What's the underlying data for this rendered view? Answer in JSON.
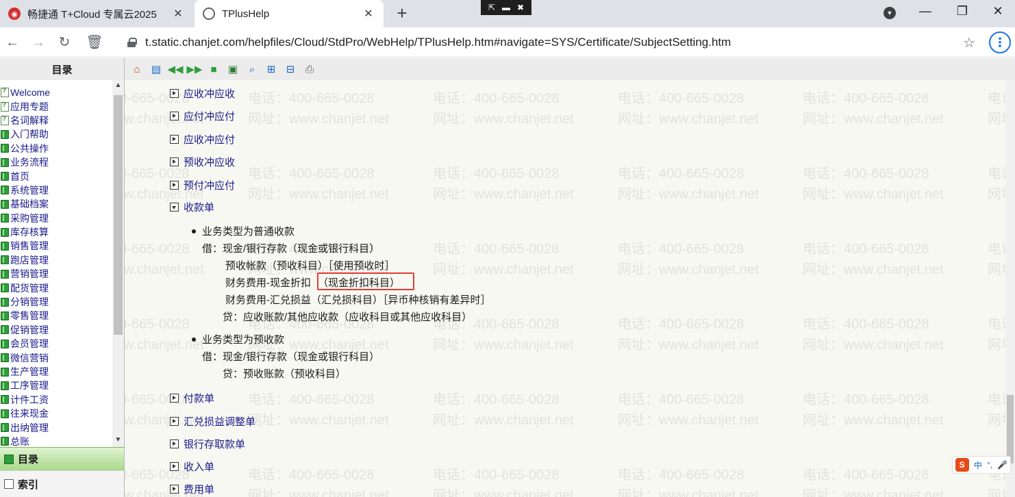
{
  "browser": {
    "tabs": [
      {
        "title": "畅捷通 T+Cloud 专属云2025",
        "active": false
      },
      {
        "title": "TPlusHelp",
        "active": true
      }
    ],
    "url": "t.static.chanjet.com/helpfiles/Cloud/StdPro/WebHelp/TPlusHelp.htm#navigate=SYS/Certificate/SubjectSetting.htm"
  },
  "help": {
    "toc_title": "目录",
    "toc_items": [
      {
        "label": "Welcome",
        "icon": "page-icon"
      },
      {
        "label": "应用专题",
        "icon": "page-icon"
      },
      {
        "label": "名词解释",
        "icon": "page-icon"
      },
      {
        "label": "入门帮助",
        "icon": "book-icon"
      },
      {
        "label": "公共操作",
        "icon": "book-icon"
      },
      {
        "label": "业务流程",
        "icon": "book-icon"
      },
      {
        "label": "首页",
        "icon": "book-icon"
      },
      {
        "label": "系统管理",
        "icon": "book-icon"
      },
      {
        "label": "基础档案",
        "icon": "book-icon"
      },
      {
        "label": "采购管理",
        "icon": "book-icon"
      },
      {
        "label": "库存核算",
        "icon": "book-icon"
      },
      {
        "label": "销售管理",
        "icon": "book-icon"
      },
      {
        "label": "跑店管理",
        "icon": "book-icon"
      },
      {
        "label": "营销管理",
        "icon": "book-icon"
      },
      {
        "label": "配货管理",
        "icon": "book-icon"
      },
      {
        "label": "分销管理",
        "icon": "book-icon"
      },
      {
        "label": "零售管理",
        "icon": "book-icon"
      },
      {
        "label": "促销管理",
        "icon": "book-icon"
      },
      {
        "label": "会员管理",
        "icon": "book-icon"
      },
      {
        "label": "微信营销",
        "icon": "book-icon"
      },
      {
        "label": "生产管理",
        "icon": "book-icon"
      },
      {
        "label": "工序管理",
        "icon": "book-icon"
      },
      {
        "label": "计件工资",
        "icon": "book-icon"
      },
      {
        "label": "往来现金",
        "icon": "book-icon"
      },
      {
        "label": "出纳管理",
        "icon": "book-icon"
      },
      {
        "label": "总账",
        "icon": "book-icon"
      }
    ],
    "panel_tabs": {
      "contents": "目录",
      "index": "索引"
    },
    "toolbar_icons": [
      "home-icon",
      "show-toc-icon",
      "previous-icon",
      "next-icon",
      "book-icon",
      "glossary-icon",
      "search-icon",
      "sync-toc-icon",
      "collapse-icon",
      "print-icon"
    ],
    "watermark": {
      "phone": "电话：400-665-0028",
      "site": "网址：www.chanjet.net"
    },
    "sections_top": [
      "应收冲应收",
      "应付冲应付",
      "应收冲应付",
      "预收冲应收",
      "预付冲应付"
    ],
    "expanded_section": "收款单",
    "receipt": {
      "type1_title": "业务类型为普通收款",
      "type1_lines": [
        "借：现金/银行存款（现金或银行科目）",
        "预收帐款（预收科目）［使用预收时］",
        "财务费用-现金折扣",
        "（现金折扣科目）",
        "财务费用-汇兑损益（汇兑损科目）［异币种核销有差异时］",
        "贷：应收账款/其他应收款（应收科目或其他应收科目）"
      ],
      "type2_title": "业务类型为预收款",
      "type2_lines": [
        "借：现金/银行存款（现金或银行科目）",
        "贷：预收账款（预收科目）"
      ]
    },
    "sections_bottom": [
      "付款单",
      "汇兑损益调整单",
      "银行存取款单",
      "收入单",
      "费用单"
    ]
  },
  "ime": {
    "label": "中"
  }
}
